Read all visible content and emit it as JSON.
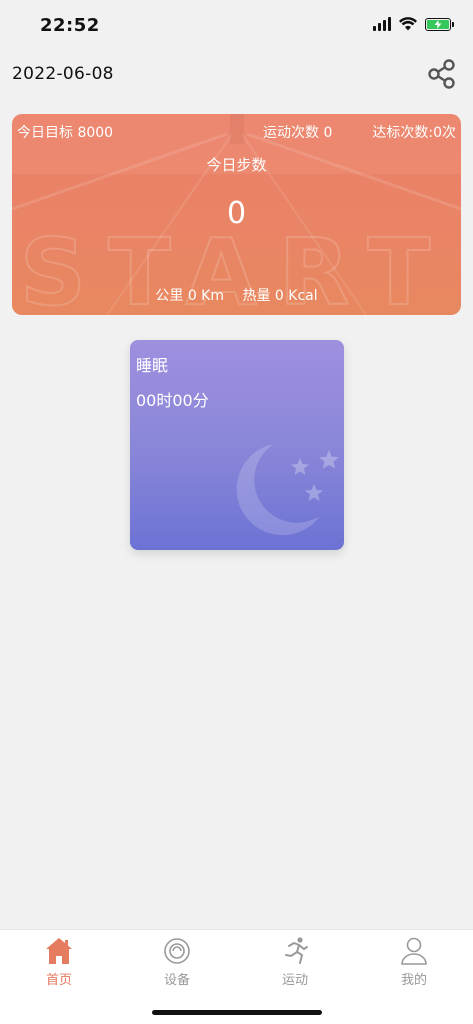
{
  "status_bar": {
    "time": "22:52",
    "icons": [
      "signal-icon",
      "wifi-icon",
      "battery-charging-icon"
    ],
    "battery_color": "#34c759"
  },
  "header": {
    "date": "2022-06-08",
    "share_icon": "share-icon"
  },
  "steps_card": {
    "goal": "今日目标 8000",
    "sport_count": "运动次数 0",
    "reach_count": "达标次数:0次",
    "title": "今日步数",
    "steps": "0",
    "distance": "公里 0 Km",
    "calories": "热量 0 Kcal",
    "background_text": "START",
    "accent": "#ec8068"
  },
  "sleep_card": {
    "title": "睡眠",
    "value": "00时00分",
    "icon": "moon-stars-icon",
    "accent": "#8a87d8"
  },
  "tab_bar": {
    "active_color": "#e57b5f",
    "tabs": [
      {
        "label": "首页",
        "icon": "home-icon",
        "active": true
      },
      {
        "label": "设备",
        "icon": "device-icon",
        "active": false
      },
      {
        "label": "运动",
        "icon": "running-icon",
        "active": false
      },
      {
        "label": "我的",
        "icon": "user-icon",
        "active": false
      }
    ]
  }
}
